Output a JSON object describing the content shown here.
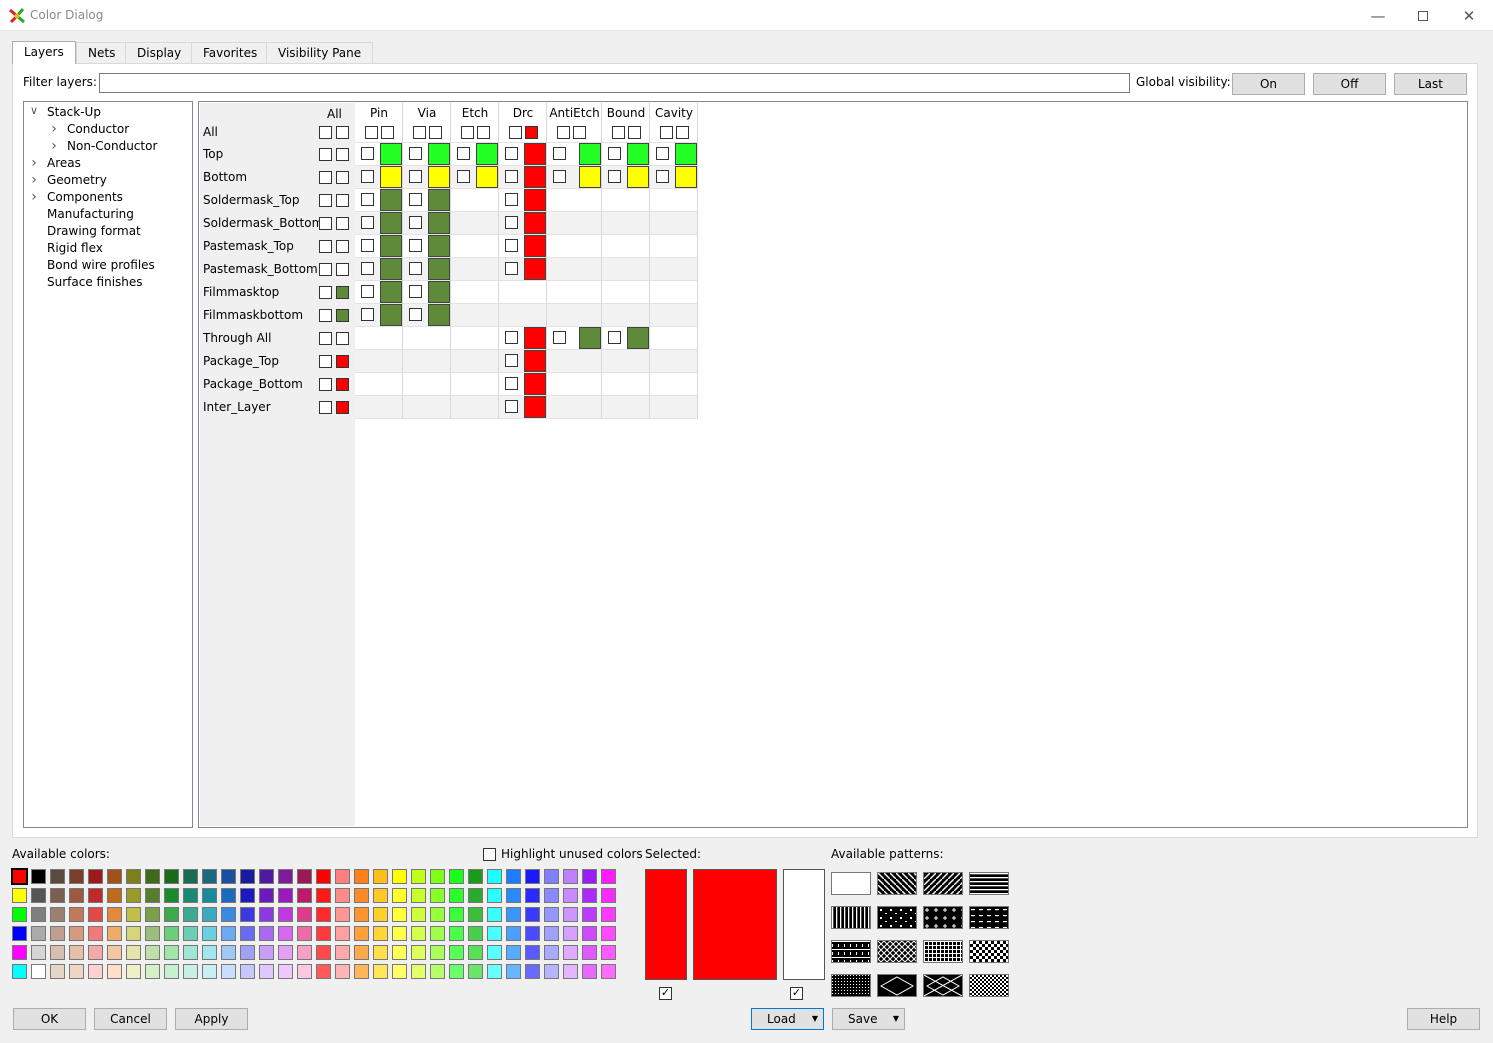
{
  "window": {
    "title": "Color Dialog"
  },
  "tabs": [
    {
      "label": "Layers",
      "active": true
    },
    {
      "label": "Nets",
      "active": false
    },
    {
      "label": "Display",
      "active": false
    },
    {
      "label": "Favorites",
      "active": false
    },
    {
      "label": "Visibility Pane",
      "active": false
    }
  ],
  "filter": {
    "label": "Filter layers:",
    "value": "",
    "placeholder": ""
  },
  "global_visibility": {
    "label": "Global visibility:",
    "on_label": "On",
    "off_label": "Off",
    "last_label": "Last"
  },
  "tree": {
    "items": [
      {
        "label": "Stack-Up",
        "chevron": "down",
        "indent": 0
      },
      {
        "label": "Conductor",
        "chevron": "right",
        "indent": 1
      },
      {
        "label": "Non-Conductor",
        "chevron": "right",
        "indent": 1
      },
      {
        "label": "Areas",
        "chevron": "right",
        "indent": 0
      },
      {
        "label": "Geometry",
        "chevron": "right",
        "indent": 0
      },
      {
        "label": "Components",
        "chevron": "right",
        "indent": 0
      },
      {
        "label": "Manufacturing",
        "chevron": "none",
        "indent": 0
      },
      {
        "label": "Drawing format",
        "chevron": "none",
        "indent": 0
      },
      {
        "label": "Rigid flex",
        "chevron": "none",
        "indent": 0
      },
      {
        "label": "Bond wire profiles",
        "chevron": "none",
        "indent": 0
      },
      {
        "label": "Surface finishes",
        "chevron": "none",
        "indent": 0
      }
    ]
  },
  "grid": {
    "all_header": "All",
    "columns": [
      "Pin",
      "Via",
      "Etch",
      "Drc",
      "AntiEtch",
      "Bound",
      "Cavity"
    ],
    "colors": {
      "G": "#22ff22",
      "Y": "#ffff00",
      "O": "#5f8a3a",
      "R": "#ff0000",
      "E": "#ffffff"
    },
    "rows": [
      {
        "label": "All",
        "all": "E",
        "cells": [
          "E",
          "E",
          "E",
          "R",
          "E",
          "E",
          "E"
        ],
        "type": "header"
      },
      {
        "label": "Top",
        "all": "E",
        "cells": [
          "G",
          "G",
          "G",
          "R",
          "G",
          "G",
          "G"
        ]
      },
      {
        "label": "Bottom",
        "all": "E",
        "cells": [
          "Y",
          "Y",
          "Y",
          "R",
          "Y",
          "Y",
          "Y"
        ]
      },
      {
        "label": "Soldermask_Top",
        "all": "E",
        "cells": [
          "O",
          "O",
          null,
          "R",
          null,
          null,
          null
        ]
      },
      {
        "label": "Soldermask_Bottom",
        "all": "E",
        "cells": [
          "O",
          "O",
          null,
          "R",
          null,
          null,
          null
        ]
      },
      {
        "label": "Pastemask_Top",
        "all": "E",
        "cells": [
          "O",
          "O",
          null,
          "R",
          null,
          null,
          null
        ]
      },
      {
        "label": "Pastemask_Bottom",
        "all": "E",
        "cells": [
          "O",
          "O",
          null,
          "R",
          null,
          null,
          null
        ]
      },
      {
        "label": "Filmmasktop",
        "all": "O",
        "cells": [
          "O",
          "O",
          null,
          null,
          null,
          null,
          null
        ]
      },
      {
        "label": "Filmmaskbottom",
        "all": "O",
        "cells": [
          "O",
          "O",
          null,
          null,
          null,
          null,
          null
        ]
      },
      {
        "label": "Through All",
        "all": "E",
        "cells": [
          null,
          null,
          null,
          "R",
          "O",
          "O",
          null
        ]
      },
      {
        "label": "Package_Top",
        "all": "R",
        "cells": [
          null,
          null,
          null,
          "R",
          null,
          null,
          null
        ]
      },
      {
        "label": "Package_Bottom",
        "all": "R",
        "cells": [
          null,
          null,
          null,
          "R",
          null,
          null,
          null
        ]
      },
      {
        "label": "Inter_Layer",
        "all": "R",
        "cells": [
          null,
          null,
          null,
          "R",
          null,
          null,
          null
        ]
      }
    ]
  },
  "available_colors": {
    "label": "Available colors:",
    "highlight_label": "Highlight unused colors",
    "highlight_checked": false,
    "rows": [
      [
        "#ff0000",
        "#000000",
        "#5c4a3d",
        "#7a3f2a",
        "#9b1a1a",
        "#a0521a",
        "#7f7f1a",
        "#3f6a1a",
        "#1a6a1a",
        "#1a6a55",
        "#1a6a7f",
        "#1a4fa0",
        "#1a1aa0",
        "#4f1aa0",
        "#7f1a9b",
        "#9b1a55",
        "#ff0000",
        "#ff7f7f",
        "#ff7f1a",
        "#ffbf1a",
        "#ffff00",
        "#bfff1a",
        "#7fff1a",
        "#1aff1a",
        "#1a9b1a",
        "#1affff",
        "#1a7fff",
        "#1a1aff",
        "#7f7fff",
        "#bf7fff",
        "#9b1aff",
        "#ff1aff"
      ],
      [
        "#ffff00",
        "#555555",
        "#7a6050",
        "#9b5a40",
        "#bf2a2a",
        "#bf6a1a",
        "#9b9b2a",
        "#557f2a",
        "#1a8a2a",
        "#1a8a70",
        "#1a8a9b",
        "#1a6abf",
        "#1a1abf",
        "#6a1abf",
        "#9b1abf",
        "#bf1a6a",
        "#ff1a1a",
        "#ff8a8a",
        "#ff8a2a",
        "#ffc72a",
        "#ffff2a",
        "#c7ff2a",
        "#8aff2a",
        "#2aff2a",
        "#2aaa2a",
        "#2affff",
        "#2a8aff",
        "#2a2aff",
        "#8a8aff",
        "#c78aff",
        "#aa2aff",
        "#ff2aff"
      ],
      [
        "#00ff00",
        "#7f7f7f",
        "#9b8070",
        "#bf7a5a",
        "#e04a4a",
        "#e08a3a",
        "#bfbf4a",
        "#7aa04a",
        "#3aaa4a",
        "#3aaa90",
        "#3aaabf",
        "#3a8ae0",
        "#3a3ae0",
        "#8a3ae0",
        "#bf3ae0",
        "#e03a8a",
        "#ff2a2a",
        "#ff9595",
        "#ff952a",
        "#ffcf2a",
        "#ffff3a",
        "#cfff3a",
        "#95ff3a",
        "#3aff3a",
        "#3abf3a",
        "#3affff",
        "#3a95ff",
        "#3a3aff",
        "#9595ff",
        "#cf95ff",
        "#bf3aff",
        "#ff3aff"
      ],
      [
        "#0000ff",
        "#aaaaaa",
        "#bfa090",
        "#d59a80",
        "#f07a7a",
        "#f0aa6a",
        "#d5d57a",
        "#9abf7a",
        "#6acf7a",
        "#6acfb5",
        "#6acfdf",
        "#6aaaf0",
        "#6a6af0",
        "#aa6af0",
        "#d56af0",
        "#f06aaa",
        "#ff3a3a",
        "#ffa0a0",
        "#ffa03a",
        "#ffd53a",
        "#ffff4a",
        "#d5ff4a",
        "#a0ff4a",
        "#4aff4a",
        "#4acf4a",
        "#4affff",
        "#4aa0ff",
        "#4a4aff",
        "#a0a0ff",
        "#d5a0ff",
        "#cf4aff",
        "#ff4aff"
      ],
      [
        "#ff00ff",
        "#d5d5d5",
        "#d5c0b0",
        "#e5bfaa",
        "#f5aaaa",
        "#f5c7a0",
        "#e5e5aa",
        "#bfdfaa",
        "#a0e5aa",
        "#a0e5d5",
        "#a0e5f0",
        "#a0c7f5",
        "#a0a0f5",
        "#c7a0f5",
        "#e5a0f5",
        "#f5a0c7",
        "#ff4a4a",
        "#ffaaaa",
        "#ffaa4a",
        "#ffdf4a",
        "#ffff5a",
        "#dfff5a",
        "#aaff5a",
        "#5aff5a",
        "#5adf5a",
        "#5affff",
        "#5aaaff",
        "#5a5aff",
        "#aaaaff",
        "#dfaaff",
        "#df5aff",
        "#ff5aff"
      ],
      [
        "#00ffff",
        "#ffffff",
        "#e5d5c7",
        "#f0d5c7",
        "#ffd0d0",
        "#ffdfc7",
        "#f0f0c7",
        "#d5f0c7",
        "#c7f0d0",
        "#c7f0e5",
        "#c7f0f5",
        "#c7dfff",
        "#c7c7ff",
        "#dfc7ff",
        "#f0c7ff",
        "#ffc7df",
        "#ff5a5a",
        "#ffb5b5",
        "#ffb55a",
        "#ffe55a",
        "#ffff6a",
        "#e5ff6a",
        "#b5ff6a",
        "#6aff6a",
        "#6ae56a",
        "#6affff",
        "#6ab5ff",
        "#6a6aff",
        "#b5b5ff",
        "#e5b5ff",
        "#e56aff",
        "#ff6aff"
      ]
    ]
  },
  "selected": {
    "label": "Selected:",
    "color1": "#ff0000",
    "color2": "#ff0000",
    "color3": "#ffffff",
    "check1": true,
    "check2": true
  },
  "patterns": {
    "label": "Available patterns:",
    "names": [
      "solid-white",
      "diag-back",
      "diag-fwd",
      "horizontal",
      "vertical",
      "dots-sparse",
      "plus-dots",
      "dashes",
      "bricks",
      "crosshatch",
      "grid",
      "checker",
      "fine-dots",
      "diamond",
      "x-diamond",
      "checker-fine"
    ]
  },
  "footer": {
    "ok": "OK",
    "cancel": "Cancel",
    "apply": "Apply",
    "load": "Load",
    "save": "Save",
    "help": "Help"
  }
}
